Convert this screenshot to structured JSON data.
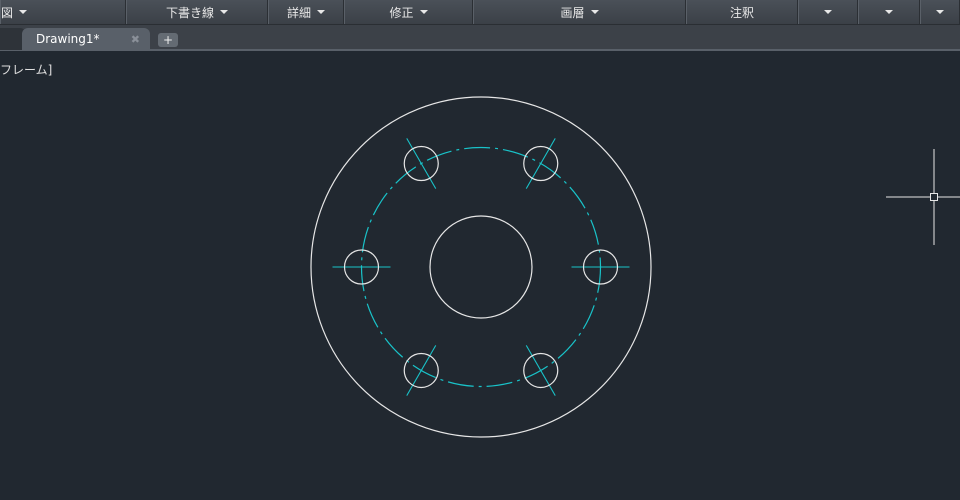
{
  "ribbon": {
    "panels": [
      {
        "label": "図",
        "has_caret": true
      },
      {
        "label": "下書き線",
        "has_caret": true
      },
      {
        "label": "詳細",
        "has_caret": true
      },
      {
        "label": "修正",
        "has_caret": true
      },
      {
        "label": "画層",
        "has_caret": true
      },
      {
        "label": "注釈",
        "has_caret": false
      },
      {
        "label": "",
        "has_caret": true
      },
      {
        "label": "",
        "has_caret": true
      },
      {
        "label": "",
        "has_caret": true
      }
    ]
  },
  "tabs": {
    "items": [
      {
        "label": "",
        "active": false
      },
      {
        "label": "Drawing1*",
        "active": true,
        "close_icon": "✖"
      }
    ],
    "new_tab_label": "+"
  },
  "viewport": {
    "visual_style_label": "ワイヤフレーム]",
    "visual_style_label_visible": "フレーム]"
  },
  "drawing": {
    "colors": {
      "background": "#212830",
      "geometry": "#e6e6e6",
      "centerline": "#19c3c9",
      "crosshair": "#e6e6e6"
    },
    "bolt_hole_count": 6,
    "bolt_hole_angles_deg": [
      0,
      60,
      120,
      180,
      240,
      300
    ]
  }
}
